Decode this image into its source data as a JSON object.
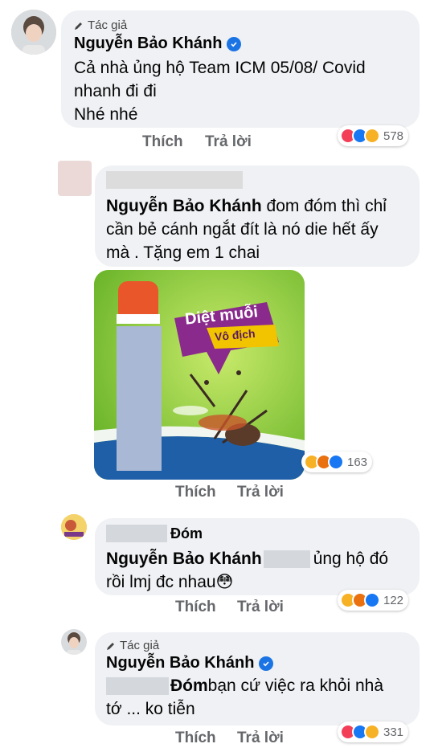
{
  "comments": [
    {
      "badge": "Tác giả",
      "author": "Nguyễn Bảo Khánh",
      "line1": "Cả nhà ủng hộ Team ICM 05/08/ Covid",
      "line2": "nhanh đi đi",
      "line3": "Nhé nhé",
      "like": "Thích",
      "reply": "Trả lời",
      "reactions": [
        "love-reaction",
        "like-reaction",
        "care-reaction"
      ],
      "count": "578"
    },
    {
      "mention": "Nguyễn Bảo Khánh",
      "line1": " đom đóm thì chỉ",
      "line2": "cần bẻ cánh ngắt đít là nó die hết ấy",
      "line3": "mà  . Tặng em 1 chai",
      "image_text1": "Diệt muỗi",
      "image_text2": "Vô địch",
      "like": "Thích",
      "reply": "Trả lời",
      "reactions": [
        "haha-reaction",
        "angry-reaction",
        "like-reaction"
      ],
      "count": "163"
    },
    {
      "author_suffix": "Đóm",
      "mention": "Nguyễn Bảo Khánh",
      "line1_rest": "ủng hộ đó",
      "line2": "rồi lmj đc nhau😳",
      "like": "Thích",
      "reply": "Trả lời",
      "reactions": [
        "haha-reaction",
        "angry-reaction",
        "like-reaction"
      ],
      "count": "122"
    },
    {
      "badge": "Tác giả",
      "author": "Nguyễn Bảo Khánh",
      "mention_suffix": "Đóm",
      "line1_rest": " bạn cứ việc ra khỏi nhà",
      "line2": "tớ ... ko tiễn",
      "like": "Thích",
      "reply": "Trả lời",
      "reactions": [
        "love-reaction",
        "like-reaction",
        "care-reaction"
      ],
      "count": "331"
    }
  ],
  "colors": {
    "bubble": "#eff1f4",
    "link_gray": "#65676b",
    "verified_blue": "#1b74e4"
  }
}
